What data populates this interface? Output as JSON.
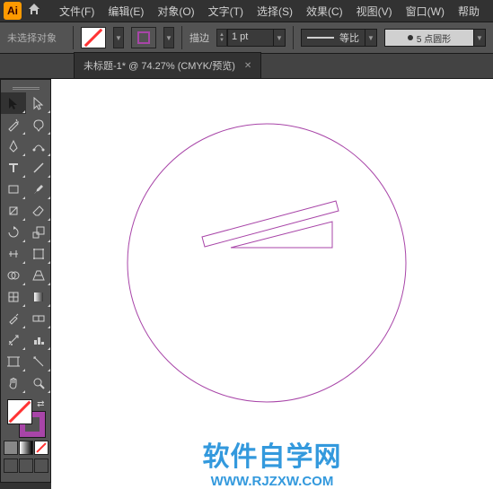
{
  "app": {
    "short": "Ai"
  },
  "menu": [
    "文件(F)",
    "编辑(E)",
    "对象(O)",
    "文字(T)",
    "选择(S)",
    "效果(C)",
    "视图(V)",
    "窗口(W)",
    "帮助"
  ],
  "control": {
    "status": "未选择对象",
    "stroke_label": "描边",
    "pt_value": "1 pt",
    "profile": "等比",
    "brush_text": "5 点圆形"
  },
  "tab": {
    "title": "未标题-1* @ 74.27% (CMYK/预览)"
  },
  "tools": [
    "selection",
    "direct-selection",
    "magic-wand",
    "lasso",
    "pen",
    "curvature",
    "type",
    "line-segment",
    "rectangle",
    "paintbrush",
    "shaper",
    "eraser",
    "rotate",
    "scale",
    "width",
    "free-transform",
    "shape-builder",
    "perspective",
    "mesh",
    "gradient",
    "eyedropper",
    "blend",
    "symbol-sprayer",
    "column-graph",
    "artboard",
    "slice",
    "hand",
    "zoom"
  ],
  "watermark": {
    "title": "软件自学网",
    "url": "WWW.RJZXW.COM"
  }
}
